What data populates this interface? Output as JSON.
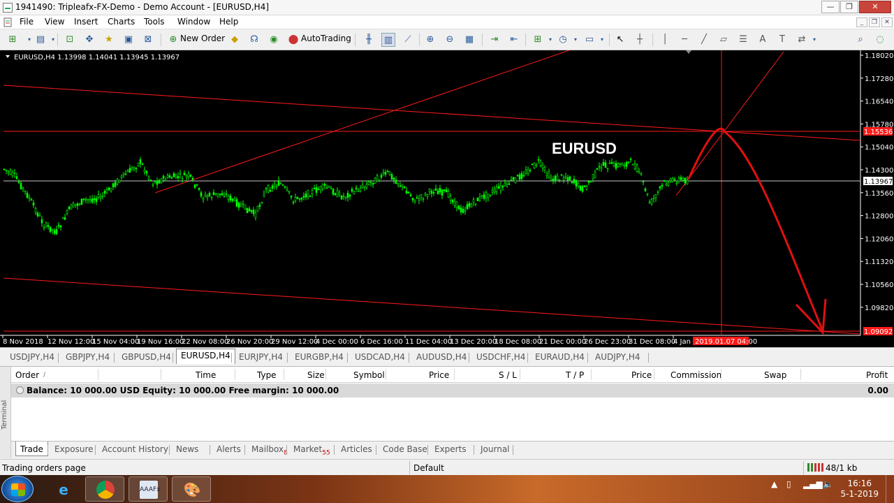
{
  "window": {
    "title": "1941490: Tripleafx-FX-Demo - Demo Account - [EURUSD,H4]"
  },
  "menu": [
    "File",
    "View",
    "Insert",
    "Charts",
    "Tools",
    "Window",
    "Help"
  ],
  "toolbar": {
    "new_order": "New Order",
    "autotrading": "AutoTrading"
  },
  "chart": {
    "info": "EURUSD,H4  1.13998 1.14041 1.13945 1.13967",
    "watermark": "EURUSD",
    "price_labels": [
      "1.18020",
      "1.17280",
      "1.16540",
      "1.15780",
      "1.15040",
      "1.14300",
      "1.13560",
      "1.12800",
      "1.12060",
      "1.11320",
      "1.10560",
      "1.09820"
    ],
    "current_price": "1.13967",
    "hline_price": "1.15536",
    "bottom_price": "1.09092",
    "time_labels": [
      "8 Nov 2018",
      "12 Nov 12:00",
      "15 Nov 04:00",
      "19 Nov 16:00",
      "22 Nov 08:00",
      "26 Nov 20:00",
      "29 Nov 12:00",
      "4 Dec 00:00",
      "6 Dec 16:00",
      "11 Dec 04:00",
      "13 Dec 20:00",
      "18 Dec 08:00",
      "21 Dec 00:00",
      "26 Dec 23:00",
      "31 Dec 08:00",
      "4 Jan 0"
    ],
    "vline_time": "2019.01.07 04:00",
    "colors": {
      "background": "#000000",
      "candles": "#00ff00",
      "lines": "#ff0000",
      "axis_text": "#ffffff"
    }
  },
  "symbol_tabs": [
    "USDJPY,H4",
    "GBPJPY,H4",
    "GBPUSD,H4",
    "EURUSD,H4",
    "EURJPY,H4",
    "EURGBP,H4",
    "USDCAD,H4",
    "AUDUSD,H4",
    "USDCHF,H4",
    "EURAUD,H4",
    "AUDJPY,H4"
  ],
  "active_symbol_tab": "EURUSD,H4",
  "terminal": {
    "side_label": "Terminal",
    "columns": [
      "Order",
      "/",
      "Time",
      "Type",
      "Size",
      "Symbol",
      "Price",
      "S / L",
      "T / P",
      "Price",
      "Commission",
      "Swap",
      "Profit"
    ],
    "balance_text": "Balance: 10 000.00 USD  Equity: 10 000.00  Free margin: 10 000.00",
    "profit": "0.00",
    "tabs": [
      {
        "label": "Trade",
        "badge": ""
      },
      {
        "label": "Exposure",
        "badge": ""
      },
      {
        "label": "Account History",
        "badge": ""
      },
      {
        "label": "News",
        "badge": ""
      },
      {
        "label": "Alerts",
        "badge": ""
      },
      {
        "label": "Mailbox",
        "badge": "8"
      },
      {
        "label": "Market",
        "badge": "55"
      },
      {
        "label": "Articles",
        "badge": ""
      },
      {
        "label": "Code Base",
        "badge": ""
      },
      {
        "label": "Experts",
        "badge": ""
      },
      {
        "label": "Journal",
        "badge": ""
      }
    ]
  },
  "status": {
    "left": "Trading orders page",
    "profile": "Default",
    "traffic": "48/1 kb"
  },
  "taskbar": {
    "time": "16:16",
    "date": "5-1-2019"
  }
}
